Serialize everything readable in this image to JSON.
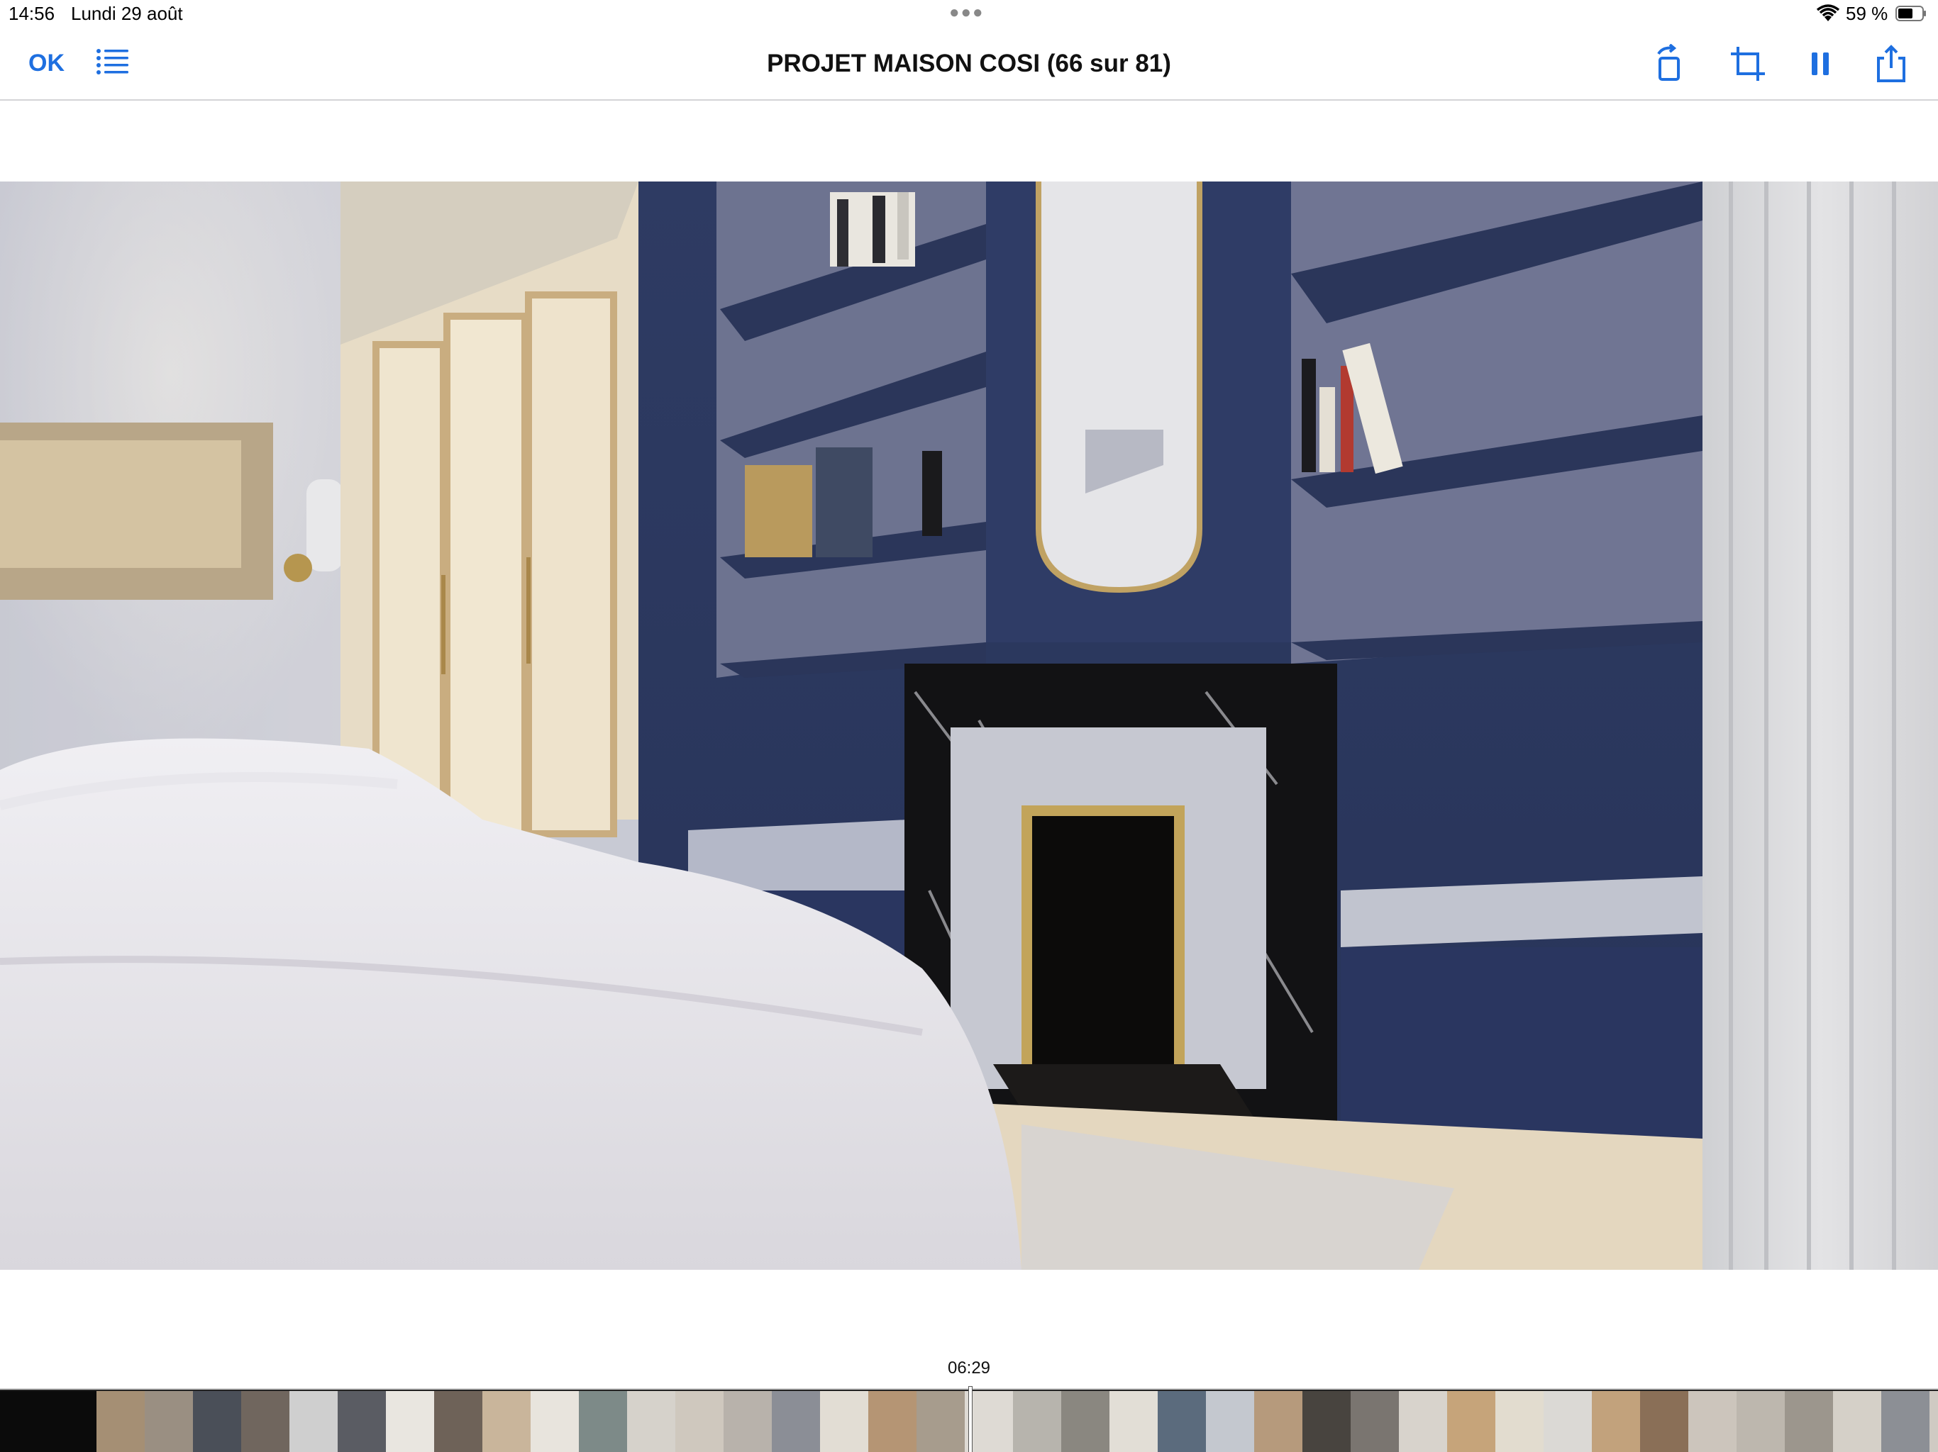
{
  "status_bar": {
    "time": "14:56",
    "date": "Lundi 29 août",
    "battery": "59 %"
  },
  "nav": {
    "done_label": "OK",
    "title": "PROJET MAISON COSI (66 sur 81)",
    "accent": "#1e6fe0"
  },
  "photo": {
    "description_icon": "bedroom-render-image"
  },
  "scrubber": {
    "timecode": "06:29",
    "thumb_colors": [
      "#0b0b0b",
      "#0b0b0b",
      "#a58f74",
      "#9a8f82",
      "#4a4f58",
      "#70665e",
      "#cfcfcf",
      "#5a5c63",
      "#e9e6e0",
      "#6e6258",
      "#c9b59b",
      "#e8e4dd",
      "#7d8a88",
      "#d6d2cb",
      "#cfc8be",
      "#b8b2ab",
      "#8b8e96",
      "#e2ddd4",
      "#b59574",
      "#a79c8d",
      "#dedad4",
      "#b7b4ad",
      "#8a8780",
      "#e2ded6",
      "#5b6b7d",
      "#c4c8cf",
      "#b69a7c",
      "#48443f",
      "#7a7570",
      "#d8d3cc",
      "#c6a47a",
      "#e2dccf",
      "#dbd9d5",
      "#c2a27c",
      "#8a6f57",
      "#ccc5bc",
      "#bdb7ae",
      "#9c968d",
      "#d5d0c8",
      "#8c8f95",
      "#cfcac3"
    ]
  }
}
